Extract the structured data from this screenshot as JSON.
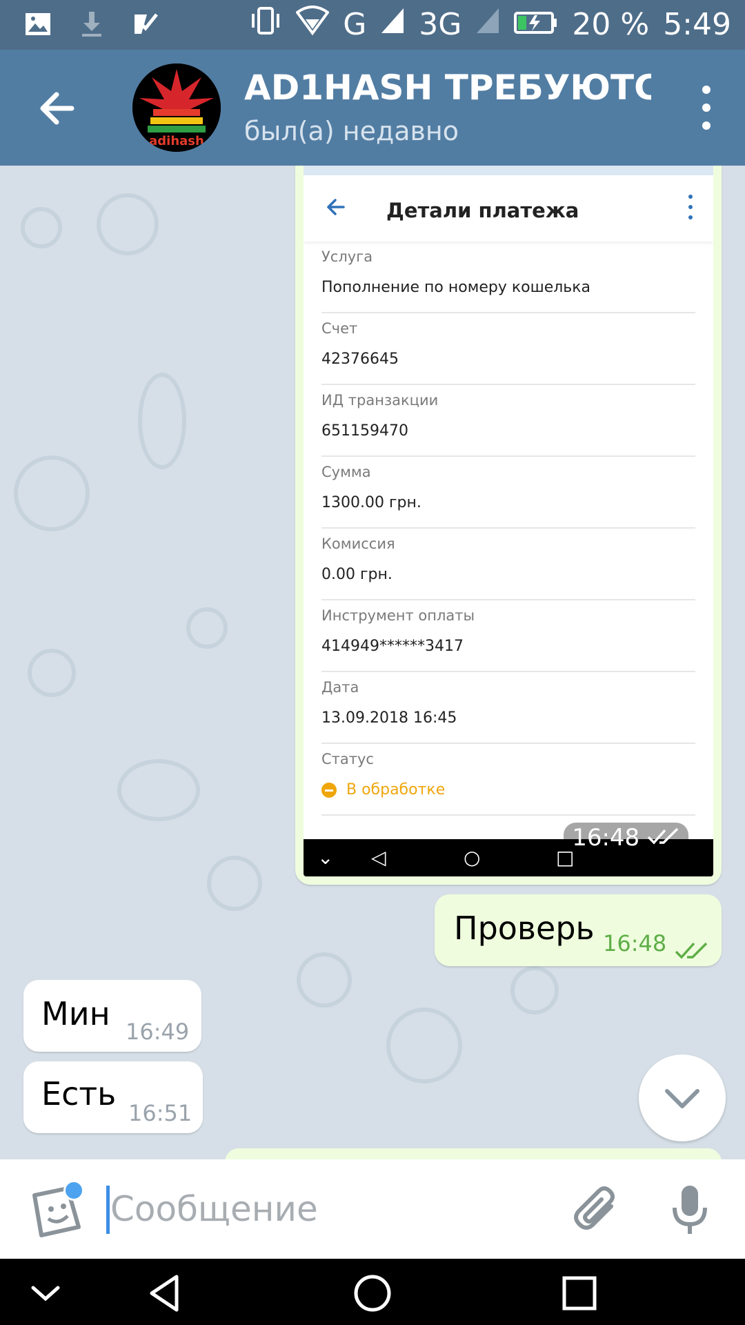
{
  "status_bar": {
    "network_1": "G",
    "network_2": "3G",
    "battery": "20 %",
    "time": "5:49"
  },
  "header": {
    "title": "AD1HASH ТРЕБУЮТС...",
    "subtitle": "был(а) недавно",
    "avatar_text": "adihash"
  },
  "messages": {
    "photo": {
      "screen_title": "Детали платежа",
      "rows": [
        {
          "label": "Услуга",
          "value": "Пополнение по номеру кошелька"
        },
        {
          "label": "Счет",
          "value": "42376645"
        },
        {
          "label": "ИД транзакции",
          "value": "651159470"
        },
        {
          "label": "Сумма",
          "value": "1300.00 грн."
        },
        {
          "label": "Комиссия",
          "value": "0.00 грн."
        },
        {
          "label": "Инструмент оплаты",
          "value": "414949******3417"
        },
        {
          "label": "Дата",
          "value": "13.09.2018 16:45"
        }
      ],
      "status_label": "Статус",
      "status_value": "В обработке",
      "time": "16:48"
    },
    "out_1": {
      "text": "Проверь",
      "time": "16:48"
    },
    "in_1": {
      "text": "Мин",
      "time": "16:49"
    },
    "in_2": {
      "text": "Есть",
      "time": "16:51"
    }
  },
  "input": {
    "placeholder": "Сообщение"
  },
  "colors": {
    "header": "#527da3",
    "status_bar": "#4e6d89",
    "outgoing_bubble": "#effdde",
    "pending_status": "#efa60b",
    "accent": "#3d8ee6"
  },
  "icons": {
    "back": "arrow-left-icon",
    "menu": "more-vertical-icon",
    "scroll_down": "chevron-down-icon",
    "emoji": "sticker-icon",
    "attach": "paperclip-icon",
    "mic": "microphone-icon"
  }
}
